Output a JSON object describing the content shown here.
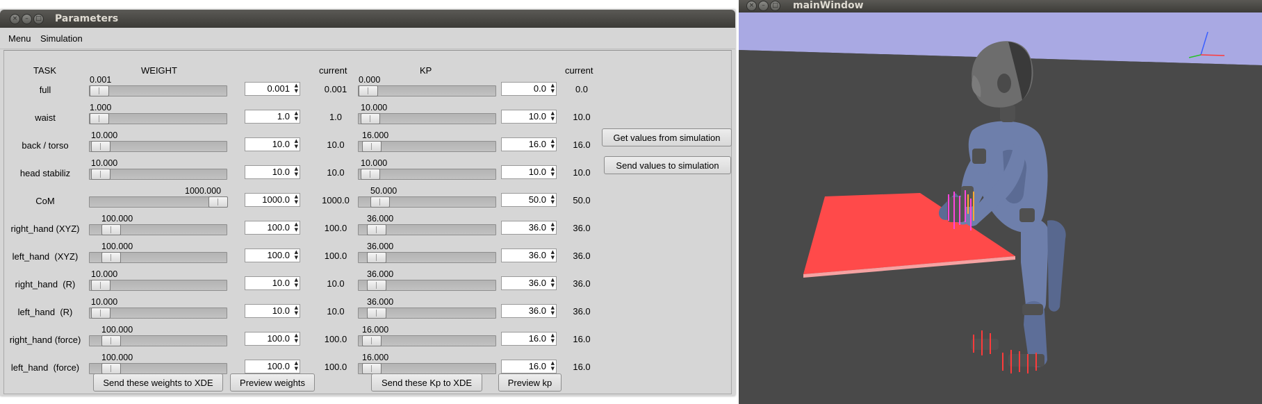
{
  "params_window": {
    "title": "Parameters",
    "menu": [
      "Menu",
      "Simulation"
    ],
    "headers": {
      "task": "TASK",
      "weight": "WEIGHT",
      "current_weight": "current",
      "kp": "KP",
      "current_kp": "current"
    },
    "rows": [
      {
        "task": "full",
        "weight_slider_value": "0.001",
        "weight_spin": "0.001",
        "weight_current": "0.001",
        "weight_fraction": 0.0,
        "kp_slider_value": "0.000",
        "kp_spin": "0.0",
        "kp_current": "0.0",
        "kp_fraction": 0.0
      },
      {
        "task": "waist",
        "weight_slider_value": "1.000",
        "weight_spin": "1.0",
        "weight_current": "1.0",
        "weight_fraction": 0.001,
        "kp_slider_value": "10.000",
        "kp_spin": "10.0",
        "kp_current": "10.0",
        "kp_fraction": 0.02
      },
      {
        "task": "back / torso",
        "weight_slider_value": "10.000",
        "weight_spin": "10.0",
        "weight_current": "10.0",
        "weight_fraction": 0.01,
        "kp_slider_value": "16.000",
        "kp_spin": "16.0",
        "kp_current": "16.0",
        "kp_fraction": 0.032
      },
      {
        "task": "head stabiliz",
        "weight_slider_value": "10.000",
        "weight_spin": "10.0",
        "weight_current": "10.0",
        "weight_fraction": 0.01,
        "kp_slider_value": "10.000",
        "kp_spin": "10.0",
        "kp_current": "10.0",
        "kp_fraction": 0.02
      },
      {
        "task": "CoM",
        "weight_slider_value": "1000.000",
        "weight_spin": "1000.0",
        "weight_current": "1000.0",
        "weight_fraction": 1.0,
        "kp_slider_value": "50.000",
        "kp_spin": "50.0",
        "kp_current": "50.0",
        "kp_fraction": 0.1
      },
      {
        "task": "right_hand (XYZ)",
        "weight_slider_value": "100.000",
        "weight_spin": "100.0",
        "weight_current": "100.0",
        "weight_fraction": 0.1,
        "kp_slider_value": "36.000",
        "kp_spin": "36.0",
        "kp_current": "36.0",
        "kp_fraction": 0.072
      },
      {
        "task": "left_hand  (XYZ)",
        "weight_slider_value": "100.000",
        "weight_spin": "100.0",
        "weight_current": "100.0",
        "weight_fraction": 0.1,
        "kp_slider_value": "36.000",
        "kp_spin": "36.0",
        "kp_current": "36.0",
        "kp_fraction": 0.072
      },
      {
        "task": "right_hand  (R)",
        "weight_slider_value": "10.000",
        "weight_spin": "10.0",
        "weight_current": "10.0",
        "weight_fraction": 0.01,
        "kp_slider_value": "36.000",
        "kp_spin": "36.0",
        "kp_current": "36.0",
        "kp_fraction": 0.072
      },
      {
        "task": "left_hand  (R)",
        "weight_slider_value": "10.000",
        "weight_spin": "10.0",
        "weight_current": "10.0",
        "weight_fraction": 0.01,
        "kp_slider_value": "36.000",
        "kp_spin": "36.0",
        "kp_current": "36.0",
        "kp_fraction": 0.072
      },
      {
        "task": "right_hand (force)",
        "weight_slider_value": "100.000",
        "weight_spin": "100.0",
        "weight_current": "100.0",
        "weight_fraction": 0.1,
        "kp_slider_value": "16.000",
        "kp_spin": "16.0",
        "kp_current": "16.0",
        "kp_fraction": 0.032
      },
      {
        "task": "left_hand  (force)",
        "weight_slider_value": "100.000",
        "weight_spin": "100.0",
        "weight_current": "100.0",
        "weight_fraction": 0.1,
        "kp_slider_value": "16.000",
        "kp_spin": "16.0",
        "kp_current": "16.0",
        "kp_fraction": 0.032
      }
    ],
    "buttons": {
      "get_values": "Get values from simulation",
      "send_values": "Send values to simulation",
      "send_weights": "Send these weights to XDE",
      "preview_weights": "Preview weights",
      "send_kp": "Send these Kp to XDE",
      "preview_kp": "Preview kp"
    }
  },
  "viewer_window": {
    "title": "mainWindow",
    "colors": {
      "sky": "#a9a9e3",
      "ground": "#494949",
      "table": "#ff4a4a",
      "robot_body": "#6e7fab",
      "robot_dark": "#505050",
      "marker": "#ff44dd"
    }
  }
}
